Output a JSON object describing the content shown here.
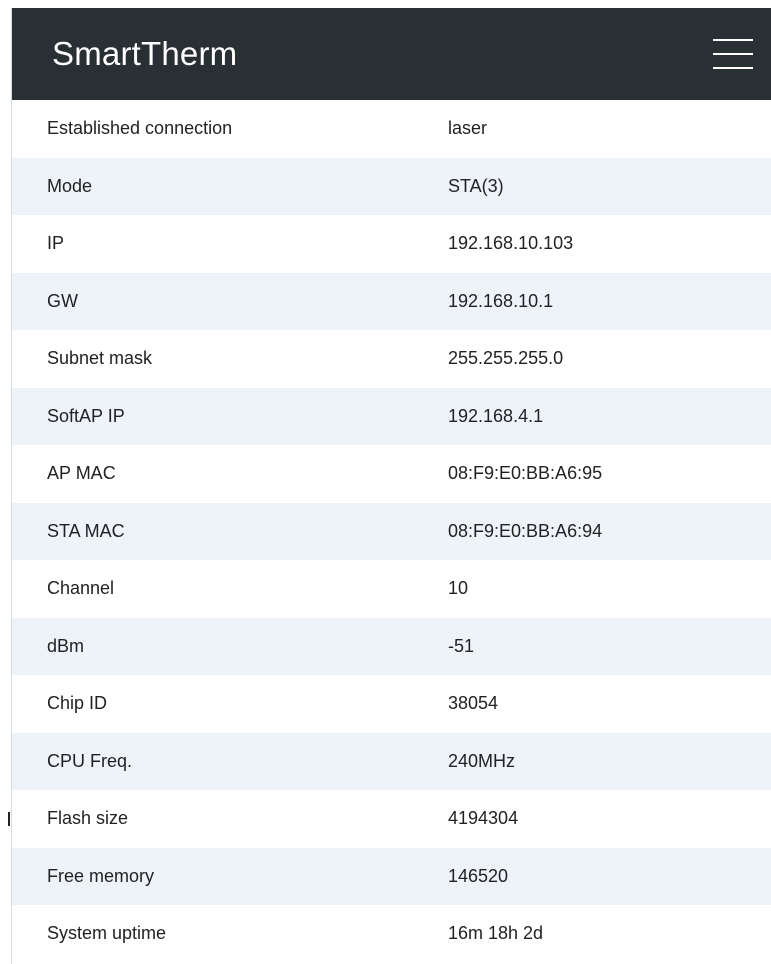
{
  "navbar": {
    "brand": "SmartTherm",
    "menu_icon": "hamburger-menu-icon"
  },
  "info_rows": [
    {
      "key": "Established connection",
      "value": "laser"
    },
    {
      "key": "Mode",
      "value": "STA(3)"
    },
    {
      "key": "IP",
      "value": "192.168.10.103"
    },
    {
      "key": "GW",
      "value": "192.168.10.1"
    },
    {
      "key": "Subnet mask",
      "value": "255.255.255.0"
    },
    {
      "key": "SoftAP IP",
      "value": "192.168.4.1"
    },
    {
      "key": "AP MAC",
      "value": "08:F9:E0:BB:A6:95"
    },
    {
      "key": "STA MAC",
      "value": "08:F9:E0:BB:A6:94"
    },
    {
      "key": "Channel",
      "value": "10"
    },
    {
      "key": "dBm",
      "value": "-51"
    },
    {
      "key": "Chip ID",
      "value": "38054"
    },
    {
      "key": "CPU Freq.",
      "value": "240MHz"
    },
    {
      "key": "Flash size",
      "value": "4194304"
    },
    {
      "key": "Free memory",
      "value": "146520"
    },
    {
      "key": "System uptime",
      "value": "16m 18h 2d"
    }
  ],
  "colors": {
    "navbar_bg": "#283034",
    "row_alt_bg": "#eef3fa",
    "text": "#222222"
  }
}
